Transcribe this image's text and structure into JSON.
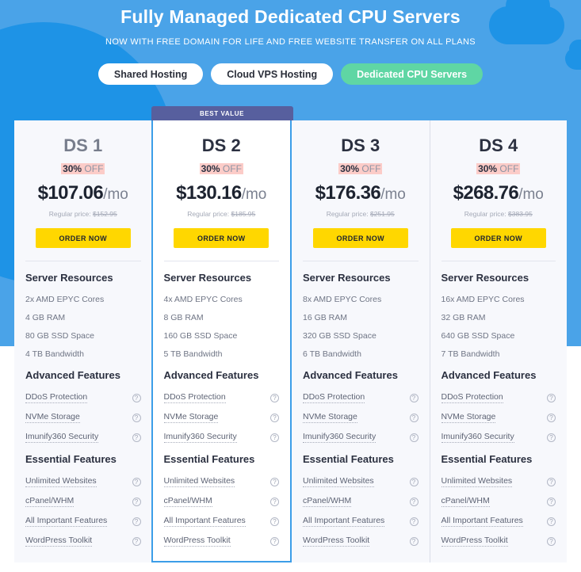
{
  "hero": {
    "title": "Fully Managed Dedicated CPU Servers",
    "subtitle": "NOW WITH FREE DOMAIN FOR LIFE AND FREE WEBSITE TRANSFER ON ALL PLANS",
    "tabs": [
      {
        "label": "Shared Hosting",
        "active": false
      },
      {
        "label": "Cloud VPS Hosting",
        "active": false
      },
      {
        "label": "Dedicated CPU Servers",
        "active": true
      }
    ],
    "colors": {
      "background": "#4aa3e8",
      "decoration": "#1e93e6",
      "active_tab": "#5fd6a4",
      "inactive_tab": "#ffffff"
    }
  },
  "badge": {
    "best_value": "BEST VALUE",
    "color": "#575f9e"
  },
  "labels": {
    "regular_price_prefix": "Regular price:",
    "order_now": "ORDER NOW",
    "period": "/mo",
    "discount_percent": "30%",
    "discount_off": "OFF",
    "section_server_resources": "Server Resources",
    "section_advanced_features": "Advanced Features",
    "section_essential_features": "Essential Features",
    "help_icon": "?"
  },
  "colors": {
    "order_button": "#ffd700",
    "discount_highlight": "#fcccc8",
    "featured_border": "#3c9ee8"
  },
  "plans": [
    {
      "name": "DS 1",
      "discount": "30%",
      "discount_off": "OFF",
      "price": "$107.06",
      "period": "/mo",
      "regular_price": "$152.95",
      "featured": false,
      "specs": [
        "2x AMD EPYC Cores",
        "4 GB RAM",
        "80 GB SSD Space",
        "4 TB Bandwidth"
      ],
      "advanced_features": [
        "DDoS Protection",
        "NVMe Storage",
        "Imunify360 Security"
      ],
      "essential_features": [
        "Unlimited Websites",
        "cPanel/WHM",
        "All Important Features",
        "WordPress Toolkit"
      ]
    },
    {
      "name": "DS 2",
      "discount": "30%",
      "discount_off": "OFF",
      "price": "$130.16",
      "period": "/mo",
      "regular_price": "$185.95",
      "featured": true,
      "specs": [
        "4x AMD EPYC Cores",
        "8 GB RAM",
        "160 GB SSD Space",
        "5 TB Bandwidth"
      ],
      "advanced_features": [
        "DDoS Protection",
        "NVMe Storage",
        "Imunify360 Security"
      ],
      "essential_features": [
        "Unlimited Websites",
        "cPanel/WHM",
        "All Important Features",
        "WordPress Toolkit"
      ]
    },
    {
      "name": "DS 3",
      "discount": "30%",
      "discount_off": "OFF",
      "price": "$176.36",
      "period": "/mo",
      "regular_price": "$251.95",
      "featured": false,
      "specs": [
        "8x AMD EPYC Cores",
        "16 GB RAM",
        "320 GB SSD Space",
        "6 TB Bandwidth"
      ],
      "advanced_features": [
        "DDoS Protection",
        "NVMe Storage",
        "Imunify360 Security"
      ],
      "essential_features": [
        "Unlimited Websites",
        "cPanel/WHM",
        "All Important Features",
        "WordPress Toolkit"
      ]
    },
    {
      "name": "DS 4",
      "discount": "30%",
      "discount_off": "OFF",
      "price": "$268.76",
      "period": "/mo",
      "regular_price": "$383.95",
      "featured": false,
      "specs": [
        "16x AMD EPYC Cores",
        "32 GB RAM",
        "640 GB SSD Space",
        "7 TB Bandwidth"
      ],
      "advanced_features": [
        "DDoS Protection",
        "NVMe Storage",
        "Imunify360 Security"
      ],
      "essential_features": [
        "Unlimited Websites",
        "cPanel/WHM",
        "All Important Features",
        "WordPress Toolkit"
      ]
    }
  ]
}
